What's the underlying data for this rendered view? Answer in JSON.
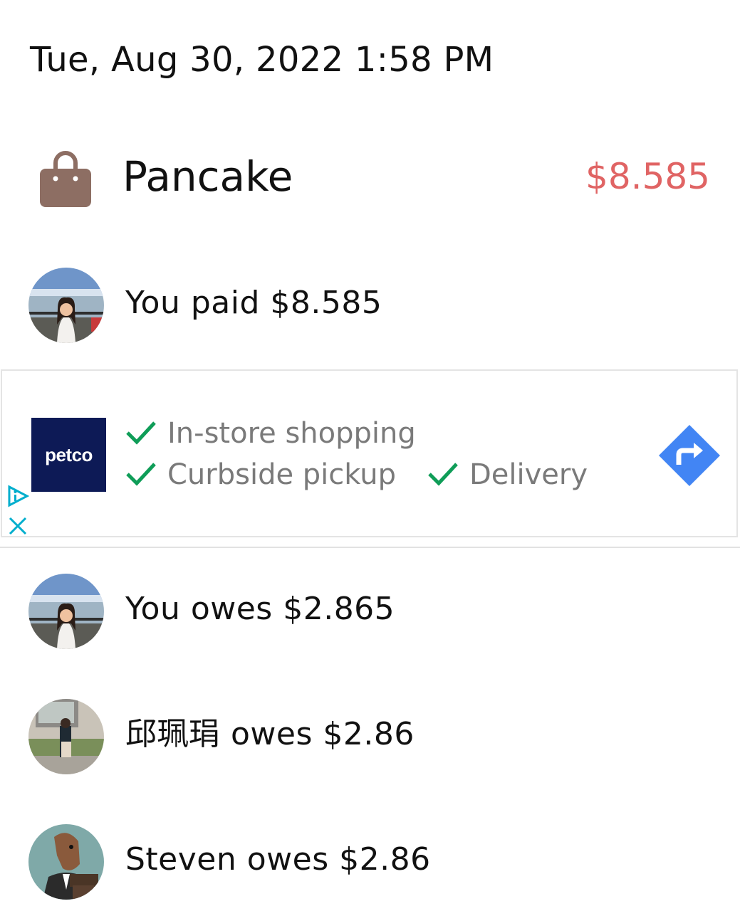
{
  "header": {
    "timestamp": "Tue, Aug 30, 2022 1:58 PM"
  },
  "expense": {
    "icon": "shopping-bag-icon",
    "title": "Pancake",
    "amount": "$8.585",
    "amount_color": "#e06464",
    "icon_color": "#8d6e63"
  },
  "payer": {
    "text": "You paid $8.585"
  },
  "ad": {
    "brand": "petco",
    "features": [
      "In-store shopping",
      "Curbside pickup",
      "Delivery"
    ],
    "check_color": "#0f9d58",
    "nav_color": "#4285f4",
    "icons": [
      "check-icon",
      "directions-icon",
      "adchoices-icon",
      "close-icon"
    ]
  },
  "splits": [
    {
      "text": "You owes $2.865"
    },
    {
      "text": "邱珮琄 owes $2.86"
    },
    {
      "text": "Steven owes $2.86"
    }
  ]
}
